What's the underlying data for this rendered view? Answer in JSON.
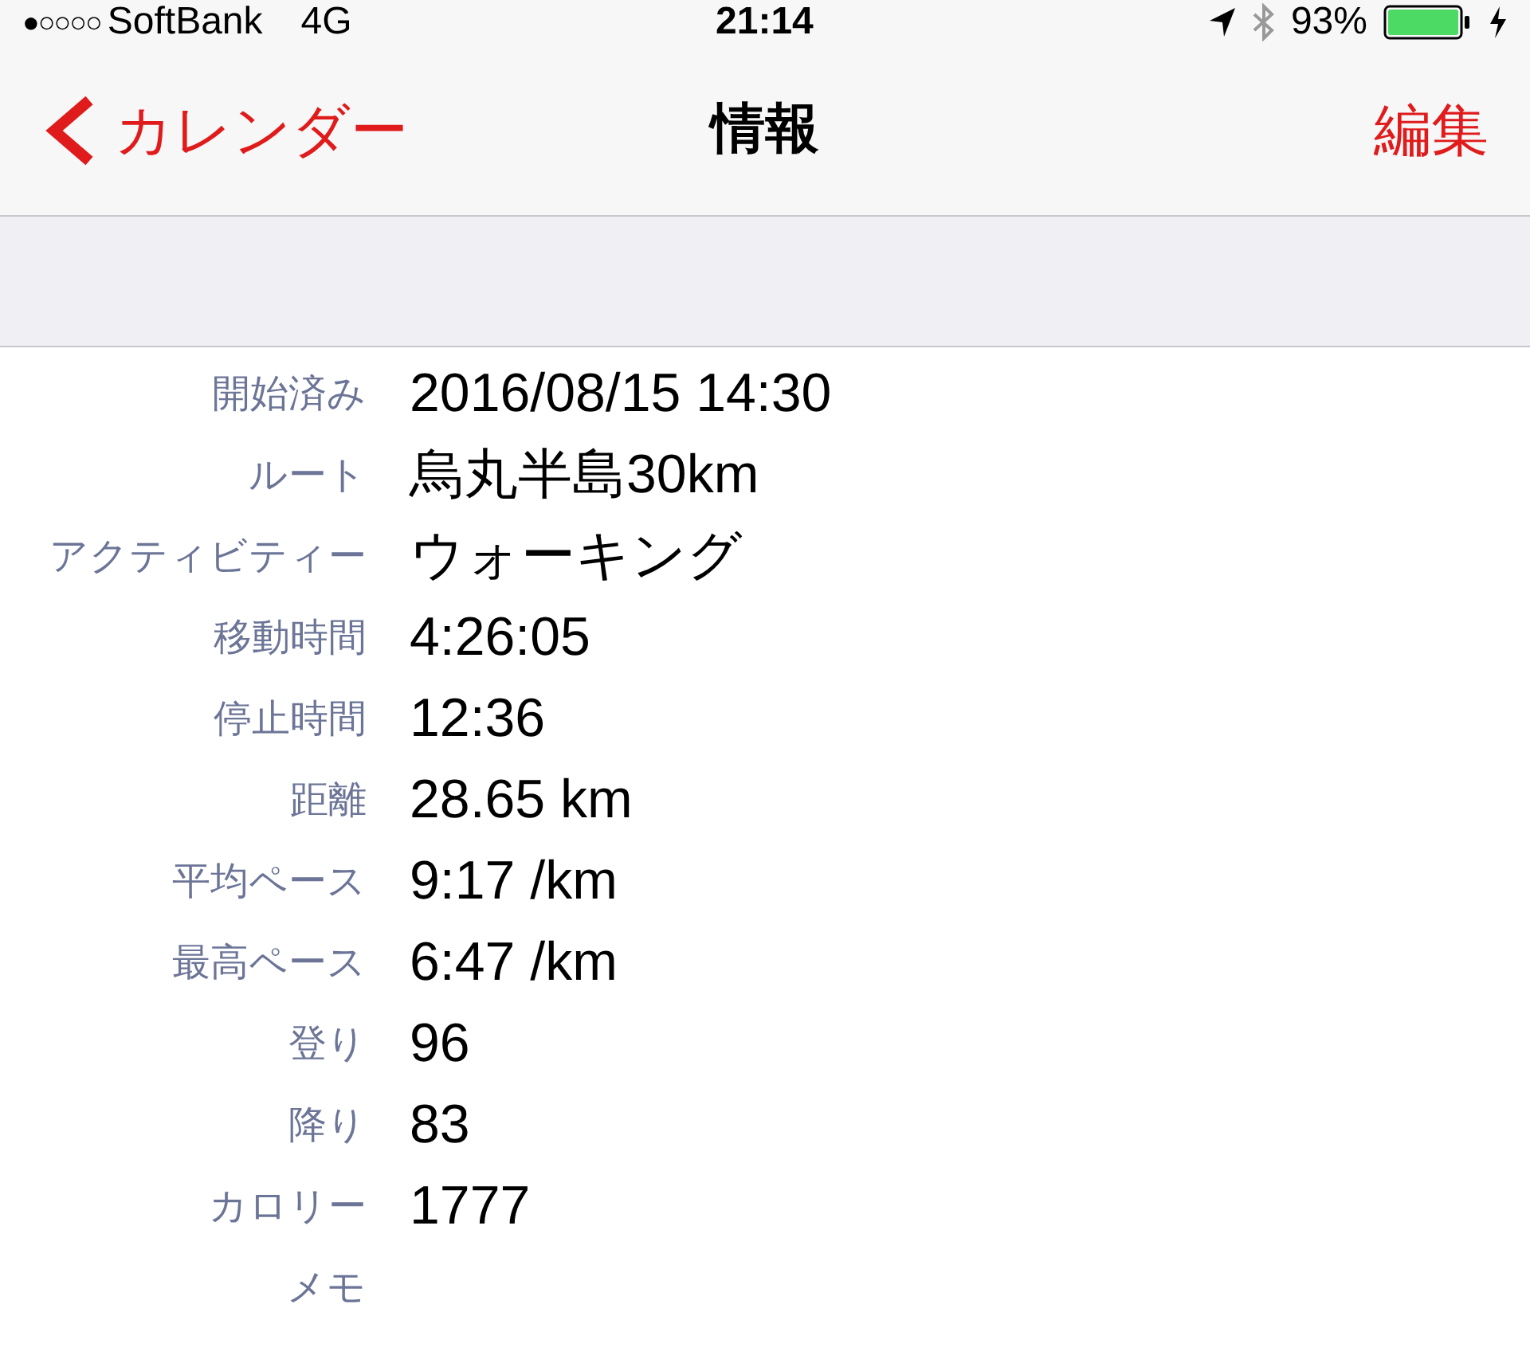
{
  "status_bar": {
    "signal": "●○○○○",
    "carrier": "SoftBank",
    "network": "4G",
    "time": "21:14",
    "battery": "93%"
  },
  "nav": {
    "back": "カレンダー",
    "title": "情報",
    "action": "編集"
  },
  "fields": [
    {
      "label": "開始済み",
      "value": "2016/08/15 14:30"
    },
    {
      "label": "ルート",
      "value": "烏丸半島30km"
    },
    {
      "label": "アクティビティー",
      "value": "ウォーキング"
    },
    {
      "label": "移動時間",
      "value": "4:26:05"
    },
    {
      "label": "停止時間",
      "value": "12:36"
    },
    {
      "label": "距離",
      "value": "28.65 km"
    },
    {
      "label": "平均ペース",
      "value": "9:17 /km"
    },
    {
      "label": "最高ペース",
      "value": "6:47 /km"
    },
    {
      "label": "登り",
      "value": "96"
    },
    {
      "label": "降り",
      "value": "83"
    },
    {
      "label": "カロリー",
      "value": "1777"
    },
    {
      "label": "メモ"
    }
  ]
}
